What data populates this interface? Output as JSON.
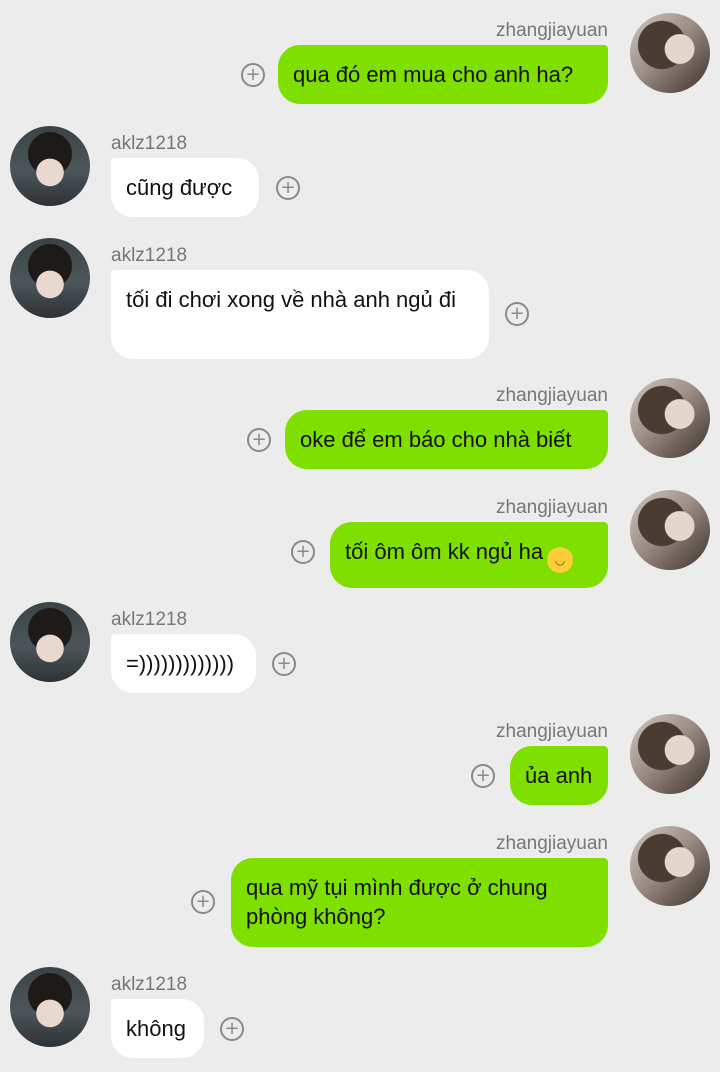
{
  "chat": {
    "messages": [
      {
        "side": "right",
        "sender": "zhangjiayuan",
        "text": "qua đó em mua cho anh ha?"
      },
      {
        "side": "left",
        "sender": "aklz1218",
        "text": "cũng được"
      },
      {
        "side": "left",
        "sender": "aklz1218",
        "text": "tối đi chơi xong về nhà anh ngủ đi"
      },
      {
        "side": "right",
        "sender": "zhangjiayuan",
        "text": "oke để em báo cho nhà biết"
      },
      {
        "side": "right",
        "sender": "zhangjiayuan",
        "text": "tối ôm ôm kk ngủ ha",
        "emoji": "grinning-face-emoji"
      },
      {
        "side": "left",
        "sender": "aklz1218",
        "text": "=)))))))))))))"
      },
      {
        "side": "right",
        "sender": "zhangjiayuan",
        "text": "ủa anh"
      },
      {
        "side": "right",
        "sender": "zhangjiayuan",
        "text": "qua mỹ tụi mình được ở chung phòng không?"
      },
      {
        "side": "left",
        "sender": "aklz1218",
        "text": "không"
      }
    ],
    "add_icon": "plus-circle-icon",
    "colors": {
      "outgoing_bubble": "#7fe000",
      "incoming_bubble": "#ffffff",
      "background": "#ececec"
    }
  }
}
